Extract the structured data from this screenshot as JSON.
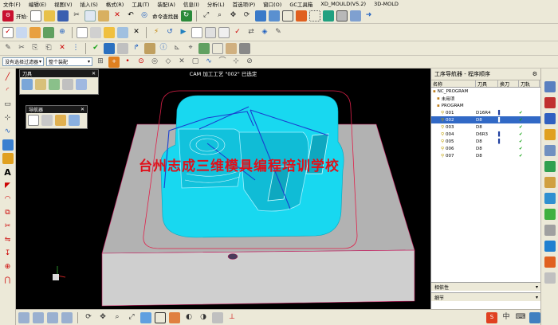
{
  "menubar": [
    "文件(F)",
    "编辑(E)",
    "视图(V)",
    "插入(S)",
    "格式(R)",
    "工具(T)",
    "装配(A)",
    "信息(I)",
    "分析(L)",
    "首选项(P)",
    "窗口(O)",
    "GC工具箱",
    "XD_MOULD(V5.2)",
    "3D-MOLD"
  ],
  "toolbar": {
    "start_label": "开始·",
    "command_finder": "命令查找器",
    "filter_combo": "没有选择过滤器",
    "assembly_combo": "整个装配"
  },
  "viewport": {
    "title": "CAM 加工工艺 \"002\" 已选定",
    "watermark": "台州志成三维模具编程培训学校"
  },
  "floating_panels": {
    "tool_title": "刀具",
    "navigator_title": "导航器"
  },
  "navigator": {
    "title": "工序导航器 - 程序顺序",
    "headers": [
      "名称",
      "刀具",
      "换刀",
      "刀轨"
    ],
    "rows": [
      {
        "name": "NC_PROGRAM",
        "tool": "",
        "change": "",
        "path": "",
        "indent": 0,
        "selected": false
      },
      {
        "name": "未用项",
        "tool": "",
        "change": "",
        "path": "",
        "indent": 1,
        "selected": false
      },
      {
        "name": "PROGRAM",
        "tool": "",
        "change": "",
        "path": "",
        "indent": 1,
        "selected": false
      },
      {
        "name": "001",
        "tool": "D16R4",
        "change": "▌",
        "path": "✔",
        "indent": 2,
        "selected": false
      },
      {
        "name": "002",
        "tool": "D8",
        "change": "▌",
        "path": "✔",
        "indent": 2,
        "selected": true
      },
      {
        "name": "003",
        "tool": "D8",
        "change": "",
        "path": "✔",
        "indent": 2,
        "selected": false
      },
      {
        "name": "004",
        "tool": "D6R3",
        "change": "▌",
        "path": "✔",
        "indent": 2,
        "selected": false
      },
      {
        "name": "005",
        "tool": "D8",
        "change": "▌",
        "path": "✔",
        "indent": 2,
        "selected": false
      },
      {
        "name": "006",
        "tool": "D8",
        "change": "",
        "path": "✔",
        "indent": 2,
        "selected": false
      },
      {
        "name": "007",
        "tool": "D8",
        "change": "",
        "path": "✔",
        "indent": 2,
        "selected": false
      }
    ],
    "footer1": "相依性",
    "footer2": "细节"
  }
}
